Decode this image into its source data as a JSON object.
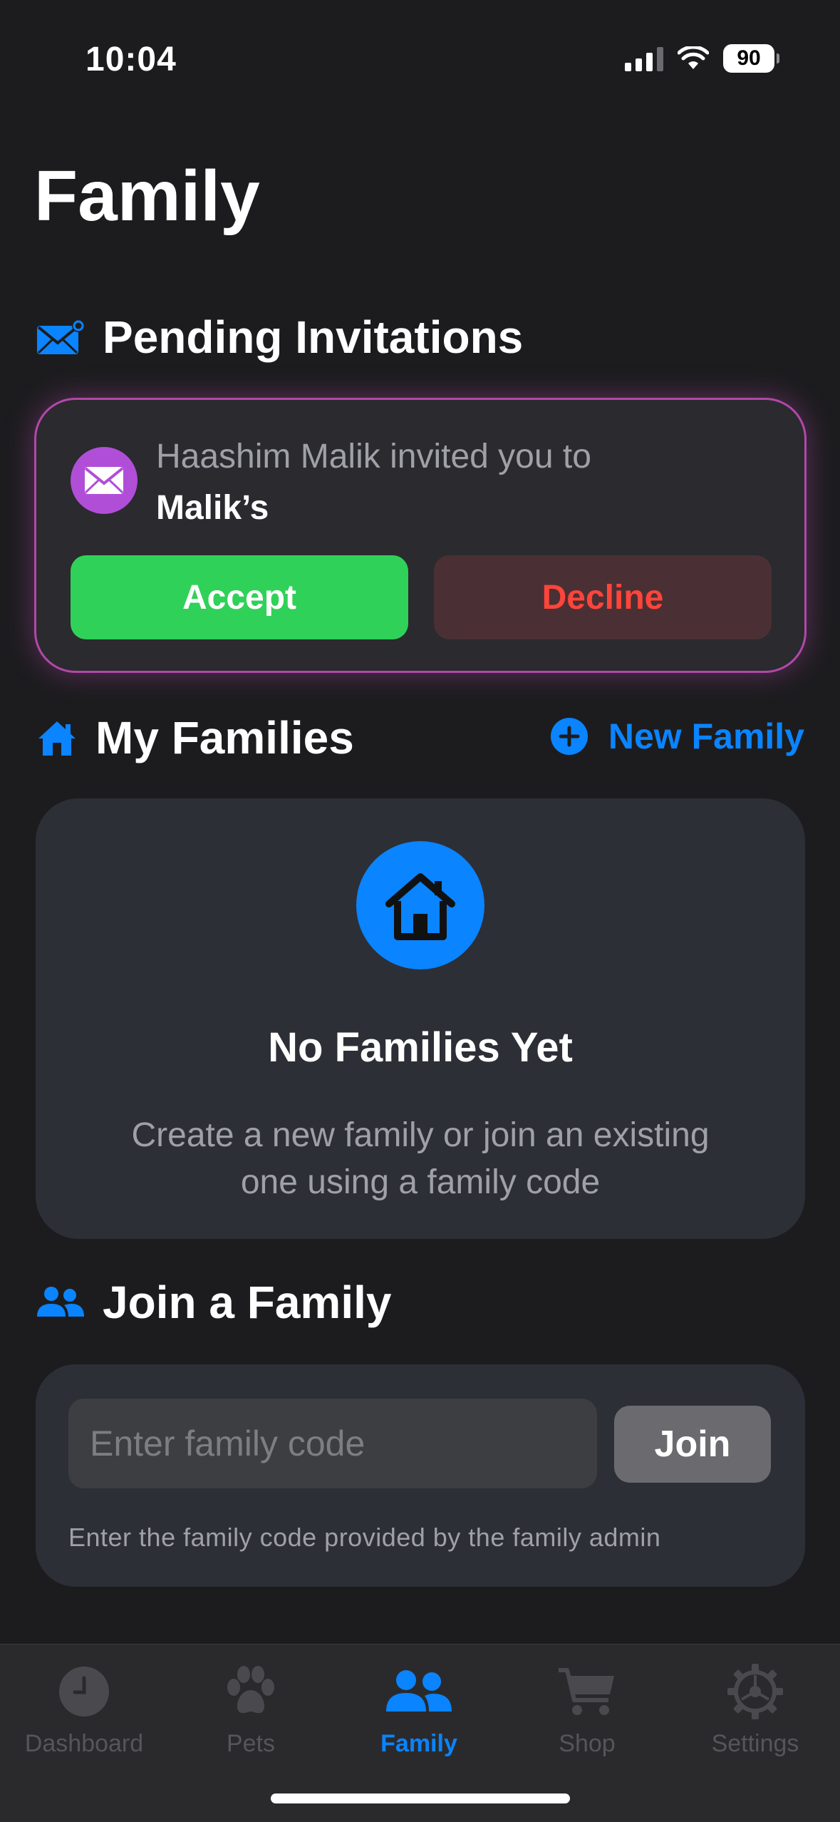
{
  "status_bar": {
    "time": "10:04",
    "battery": "90"
  },
  "page": {
    "title": "Family"
  },
  "pending": {
    "header": "Pending Invitations",
    "invite_line1": "Haashim Malik invited you to",
    "family_name": "Malik’s",
    "accept_label": "Accept",
    "decline_label": "Decline"
  },
  "my_families": {
    "header": "My Families",
    "new_family_label": "New Family",
    "empty_title": "No Families Yet",
    "empty_desc": "Create a new family or join an existing one using a family code"
  },
  "join": {
    "header": "Join a Family",
    "placeholder": "Enter family code",
    "button_label": "Join",
    "hint": "Enter the family code provided by the family admin"
  },
  "tabs": [
    {
      "label": "Dashboard",
      "icon": "clock-icon",
      "active": false
    },
    {
      "label": "Pets",
      "icon": "paw-icon",
      "active": false
    },
    {
      "label": "Family",
      "icon": "people-icon",
      "active": true
    },
    {
      "label": "Shop",
      "icon": "cart-icon",
      "active": false
    },
    {
      "label": "Settings",
      "icon": "gear-icon",
      "active": false
    }
  ],
  "colors": {
    "background": "#1c1c1e",
    "accent_blue": "#0a84ff",
    "accept_green": "#30d158",
    "decline_red": "#ff453a",
    "invite_purple": "#b14ed8"
  }
}
